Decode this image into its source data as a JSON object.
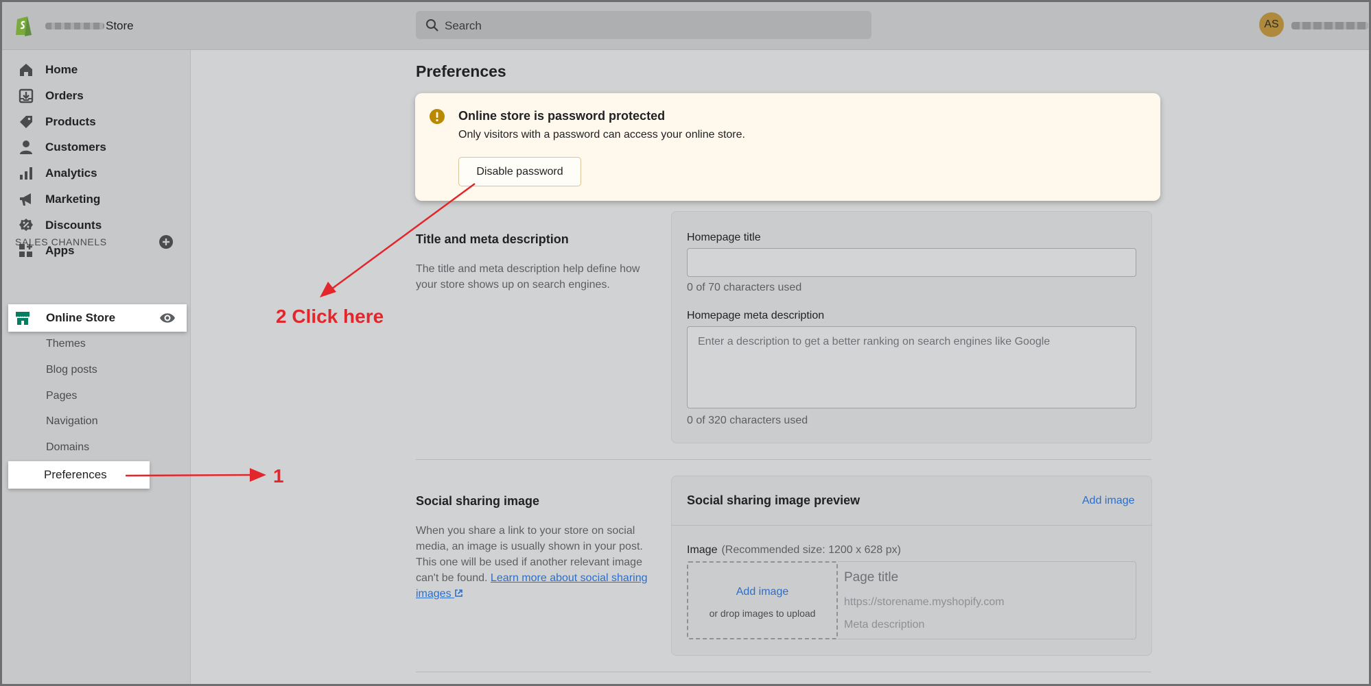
{
  "header": {
    "store_name": "Store",
    "search_placeholder": "Search",
    "avatar_initials": "AS"
  },
  "sidebar": {
    "items": [
      {
        "label": "Home",
        "icon": "home-icon"
      },
      {
        "label": "Orders",
        "icon": "orders-icon"
      },
      {
        "label": "Products",
        "icon": "tag-icon"
      },
      {
        "label": "Customers",
        "icon": "person-icon"
      },
      {
        "label": "Analytics",
        "icon": "bar-chart-icon"
      },
      {
        "label": "Marketing",
        "icon": "megaphone-icon"
      },
      {
        "label": "Discounts",
        "icon": "discount-icon"
      },
      {
        "label": "Apps",
        "icon": "apps-icon"
      }
    ],
    "sales_channels_label": "SALES CHANNELS",
    "online_store_label": "Online Store",
    "sub_items": [
      "Themes",
      "Blog posts",
      "Pages",
      "Navigation",
      "Domains",
      "Preferences"
    ]
  },
  "main": {
    "page_title": "Preferences",
    "banner": {
      "title": "Online store is password protected",
      "text": "Only visitors with a password can access your online store.",
      "button": "Disable password"
    },
    "meta_section": {
      "title": "Title and meta description",
      "description": "The title and meta description help define how your store shows up on search engines.",
      "homepage_title_label": "Homepage title",
      "homepage_title_value": "",
      "homepage_title_help": "0 of 70 characters used",
      "meta_description_label": "Homepage meta description",
      "meta_description_placeholder": "Enter a description to get a better ranking on search engines like Google",
      "meta_description_help": "0 of 320 characters used"
    },
    "social_section": {
      "title": "Social sharing image",
      "description": "When you share a link to your store on social media, an image is usually shown in your post. This one will be used if another relevant image can't be found.",
      "learn_more": "Learn more about social sharing images",
      "card_title": "Social sharing image preview",
      "add_image_link": "Add image",
      "image_label": "Image",
      "image_recommendation": "(Recommended size: 1200 x 628 px)",
      "drop_add_image": "Add image",
      "drop_hint": "or drop images to upload",
      "preview_page_title": "Page title",
      "preview_url": "https://storename.myshopify.com",
      "preview_meta": "Meta description"
    }
  },
  "annotations": {
    "step1": "1",
    "step2": "2 Click here"
  },
  "colors": {
    "accent_link": "#2c6ecb",
    "annotation_red": "#e3262b",
    "brand_green": "#008060",
    "warning": "#b98900"
  }
}
